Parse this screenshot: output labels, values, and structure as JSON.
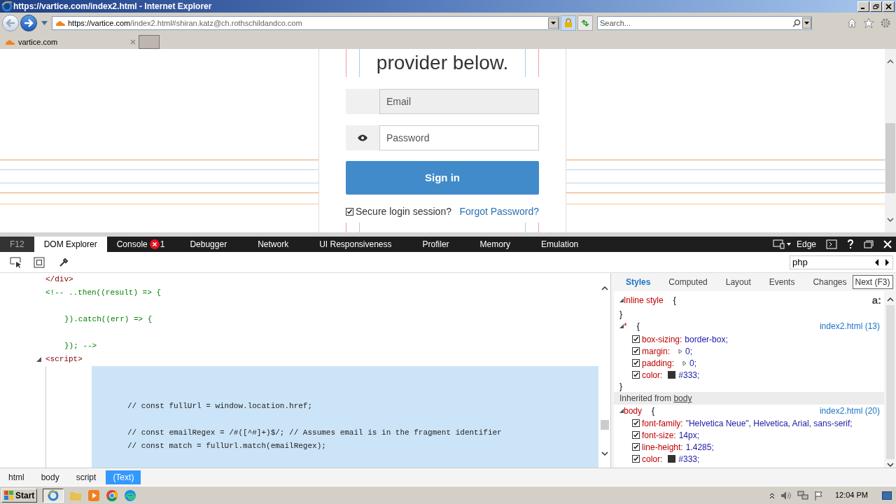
{
  "window": {
    "title": "https://vartice.com/index2.html - Internet Explorer"
  },
  "browser": {
    "address_host": "https://vartice.com",
    "address_path": "/index2.html#shiran.katz@ch.rothschildandco.com",
    "search_placeholder": "Search...",
    "tab": "vartice.com"
  },
  "page": {
    "heading": "provider below.",
    "email_placeholder": "Email",
    "password_placeholder": "Password",
    "sign_in": "Sign in",
    "secure": {
      "label": "Secure login session?",
      "checked": true
    },
    "forgot": "Forgot Password?"
  },
  "devtools": {
    "tabs": [
      {
        "label": "F12",
        "selected": false
      },
      {
        "label": "DOM Explorer",
        "selected": true
      },
      {
        "label": "Console",
        "selected": false,
        "errors": "1"
      },
      {
        "label": "Debugger",
        "selected": false
      },
      {
        "label": "Network",
        "selected": false
      },
      {
        "label": "UI Responsiveness",
        "selected": false
      },
      {
        "label": "Profiler",
        "selected": false
      },
      {
        "label": "Memory",
        "selected": false
      },
      {
        "label": "Emulation",
        "selected": false
      }
    ],
    "mode": "Edge",
    "find": "php",
    "tooltip": "Next (F3)",
    "dom": {
      "lines": [
        {
          "kind": "tag",
          "text": "</div>"
        },
        {
          "kind": "comment",
          "text": "<!-- ..then((result) => {"
        },
        {
          "kind": "blank"
        },
        {
          "kind": "comment-inner",
          "text": "}).catch((err) => {"
        },
        {
          "kind": "blank"
        },
        {
          "kind": "comment-inner",
          "text": "}); -->"
        }
      ],
      "script": {
        "tag": "<script>",
        "expanded": true,
        "text_node": {
          "selected": true,
          "lines": [
            {
              "kind": "blank"
            },
            {
              "kind": "blank"
            },
            {
              "kind": "code",
              "text": "// const fullUrl = window.location.href;"
            },
            {
              "kind": "blank"
            },
            {
              "kind": "code",
              "text": "// const emailRegex = /#([^#]+)$/; // Assumes email is in the fragment identifier"
            },
            {
              "kind": "code",
              "text": "// const match = fullUrl.match(emailRegex);"
            }
          ]
        }
      }
    },
    "breadcrumb": [
      {
        "label": "html",
        "selected": false
      },
      {
        "label": "body",
        "selected": false
      },
      {
        "label": "script",
        "selected": false
      },
      {
        "label": "(Text)",
        "selected": true
      }
    ],
    "style_tabs": [
      {
        "label": "Styles",
        "selected": true
      },
      {
        "label": "Computed",
        "selected": false
      },
      {
        "label": "Layout",
        "selected": false
      },
      {
        "label": "Events",
        "selected": false
      },
      {
        "label": "Changes",
        "selected": false
      }
    ],
    "styles": {
      "inline": {
        "selector": "Inline style",
        "open": "{",
        "close": "}",
        "badge": "a:"
      },
      "rule": {
        "selector": "*",
        "open": "{",
        "close": "}",
        "source": "index2.html (13)",
        "props": [
          {
            "kind": "plain",
            "name": "box-sizing:",
            "value": "border-box;",
            "checked": true
          },
          {
            "kind": "shorthand",
            "name": "margin:",
            "value": "0;",
            "checked": true
          },
          {
            "kind": "shorthand",
            "name": "padding:",
            "value": "0;",
            "checked": true
          },
          {
            "kind": "color",
            "name": "color:",
            "value": "#333;",
            "color": "#333333",
            "checked": true
          }
        ]
      },
      "inherited": {
        "label": "Inherited from",
        "element": "body"
      },
      "body_rule": {
        "selector": "body",
        "open": "{",
        "source": "index2.html (20)",
        "props": [
          {
            "kind": "plain",
            "name": "font-family:",
            "value": "\"Helvetica Neue\", Helvetica, Arial, sans-serif;",
            "checked": true
          },
          {
            "kind": "plain",
            "name": "font-size:",
            "value": "14px;",
            "checked": true
          },
          {
            "kind": "plain",
            "name": "line-height:",
            "value": "1.4285;",
            "checked": true
          },
          {
            "kind": "color",
            "name": "color:",
            "value": "#333;",
            "color": "#333333",
            "checked": true
          }
        ]
      }
    }
  },
  "taskbar": {
    "start": "Start",
    "time": "12:04 PM"
  }
}
